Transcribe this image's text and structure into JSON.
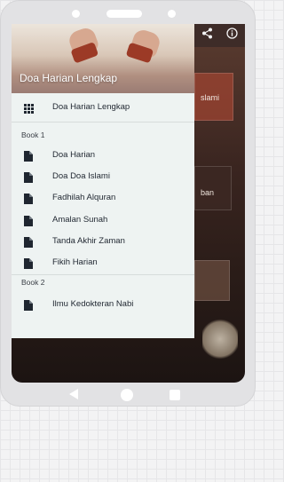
{
  "drawer": {
    "header_title": "Doa Harian Lengkap",
    "top_item": {
      "label": "Doa Harian Lengkap",
      "icon": "grid-icon"
    },
    "sections": [
      {
        "title": "Book 1",
        "items": [
          {
            "label": "Doa Harian",
            "icon": "book-icon"
          },
          {
            "label": "Doa Doa Islami",
            "icon": "book-icon"
          },
          {
            "label": "Fadhilah Alquran",
            "icon": "book-icon"
          },
          {
            "label": "Amalan Sunah",
            "icon": "book-icon"
          },
          {
            "label": "Tanda Akhir Zaman",
            "icon": "book-icon"
          },
          {
            "label": "Fikih Harian",
            "icon": "book-icon"
          }
        ]
      },
      {
        "title": "Book 2",
        "items": [
          {
            "label": "Ilmu Kedokteran Nabi",
            "icon": "book-icon"
          }
        ]
      }
    ]
  },
  "background": {
    "cards": [
      {
        "label": "slami"
      },
      {
        "label": "ban"
      }
    ],
    "toolbar_icons": [
      "share-icon",
      "info-icon"
    ]
  },
  "system_nav": [
    "back-icon",
    "home-icon",
    "recents-icon"
  ]
}
